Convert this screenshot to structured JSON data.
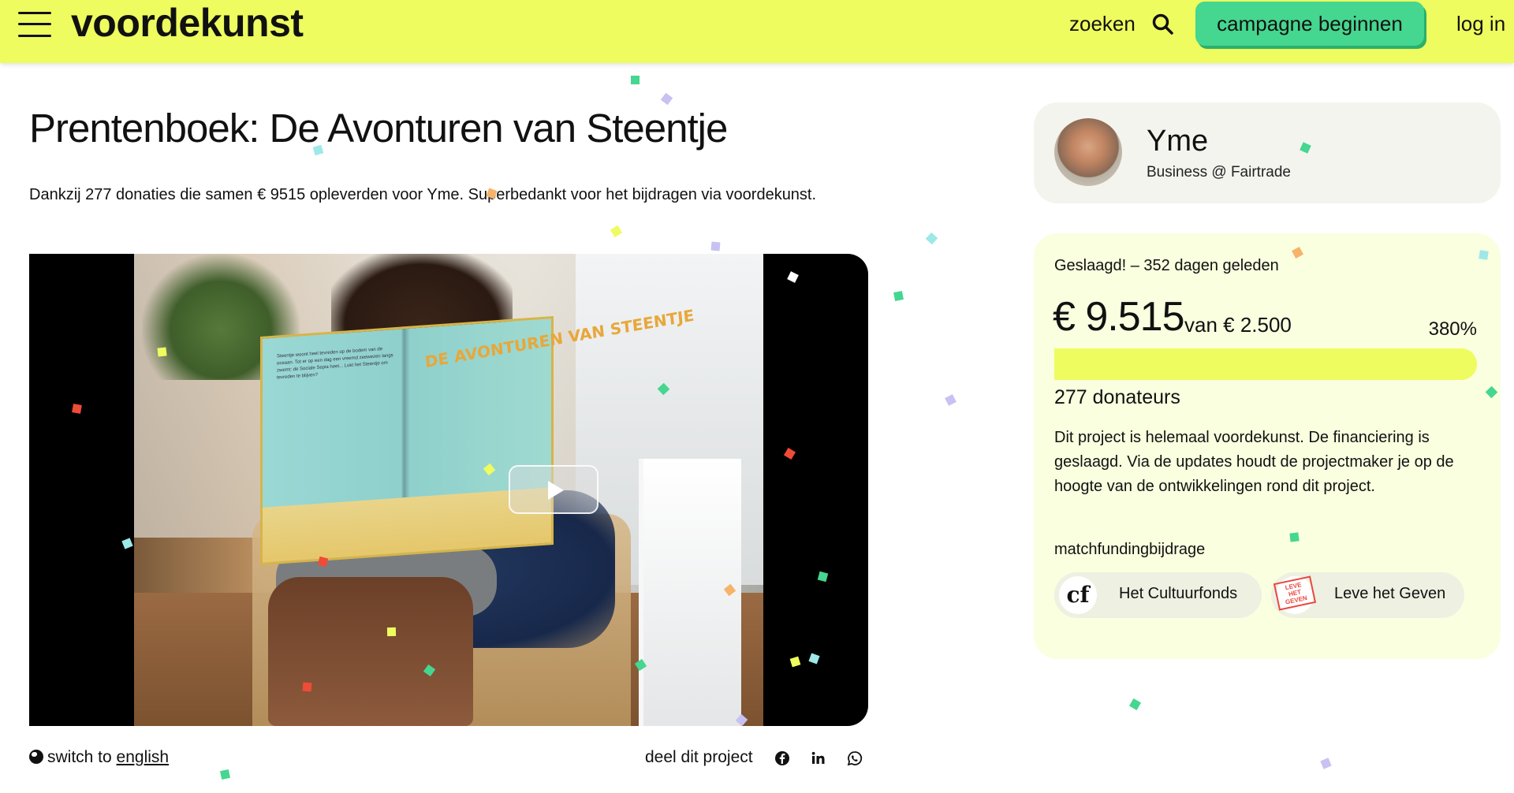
{
  "header": {
    "logo": "voordekunst",
    "search_label": "zoeken",
    "cta_label": "campagne beginnen",
    "login_label": "log in"
  },
  "project": {
    "title": "Prentenboek: De Avonturen van Steentje",
    "summary": "Dankzij 277 donaties die samen € 9515 opleverden voor Yme. Superbedankt voor het bijdragen via voordekunst.",
    "book_title": "DE AVONTUREN VAN STEENTJE",
    "book_subtitle": "Steentje en Sociale Sepia",
    "book_text": "Steentje woont heel tevreden op de bodem van de oceaan. Tot er op een dag een vreemd zeewezen langs zwemt: de Sociale Sepia heet... Lukt het Steentje om tevreden te blijven?"
  },
  "footer_row": {
    "switch_prefix": "switch to",
    "switch_link": "english",
    "share_label": "deel dit project"
  },
  "creator": {
    "name": "Yme",
    "role": "Business @ Fairtrade"
  },
  "funding": {
    "status": "Geslaagd! – 352 dagen geleden",
    "raised": "€ 9.515",
    "goal": "van € 2.500",
    "percent": "380%",
    "progress_fraction": 1.0,
    "donors": "277 donateurs",
    "description": "Dit project is helemaal voordekunst. De financiering is geslaagd. Via de updates houdt de projectmaker je op de hoogte van de ontwikkelingen rond dit project.",
    "match_label": "matchfundingbijdrage",
    "partners": [
      {
        "name": "Het Cultuurfonds",
        "logo_text": "cf"
      },
      {
        "name": "Leve het Geven",
        "logo_text": "LEVE HET GEVEN"
      }
    ]
  },
  "colors": {
    "header_bg": "#eefc5f",
    "cta_bg": "#45d68f",
    "progress": "#eefc5f",
    "card_bg": "#f9ffdf"
  }
}
